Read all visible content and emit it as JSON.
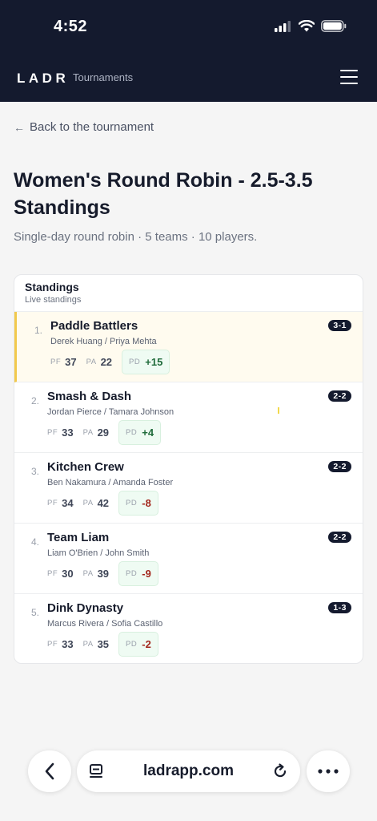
{
  "status": {
    "time": "4:52"
  },
  "header": {
    "brand": "LADR",
    "nav": "Tournaments"
  },
  "back_link": {
    "arrow": "←",
    "label": "Back to the tournament"
  },
  "page": {
    "title": "Women's Round Robin - 2.5-3.5 Standings",
    "subtitle": "Single-day round robin · 5 teams · 10 players."
  },
  "card": {
    "title": "Standings",
    "subtitle": "Live standings"
  },
  "labels": {
    "pf": "PF",
    "pa": "PA",
    "pd": "PD"
  },
  "teams": [
    {
      "rank": "1.",
      "name": "Paddle Battlers",
      "players": "Derek Huang / Priya Mehta",
      "record": "3-1",
      "pf": "37",
      "pa": "22",
      "pd": "+15"
    },
    {
      "rank": "2.",
      "name": "Smash & Dash",
      "players": "Jordan Pierce / Tamara Johnson",
      "record": "2-2",
      "pf": "33",
      "pa": "29",
      "pd": "+4"
    },
    {
      "rank": "3.",
      "name": "Kitchen Crew",
      "players": "Ben Nakamura / Amanda Foster",
      "record": "2-2",
      "pf": "34",
      "pa": "42",
      "pd": "-8"
    },
    {
      "rank": "4.",
      "name": "Team Liam",
      "players": "Liam O'Brien / John Smith",
      "record": "2-2",
      "pf": "30",
      "pa": "39",
      "pd": "-9"
    },
    {
      "rank": "5.",
      "name": "Dink Dynasty",
      "players": "Marcus Rivera / Sofia Castillo",
      "record": "1-3",
      "pf": "33",
      "pa": "35",
      "pd": "-2"
    }
  ],
  "browser": {
    "url": "ladrapp.com"
  },
  "colors": {
    "header_bg": "#141a2e",
    "leader_accent": "#f2c94c",
    "pd_positive": "#1f6b3a",
    "pd_negative": "#a3261c"
  }
}
